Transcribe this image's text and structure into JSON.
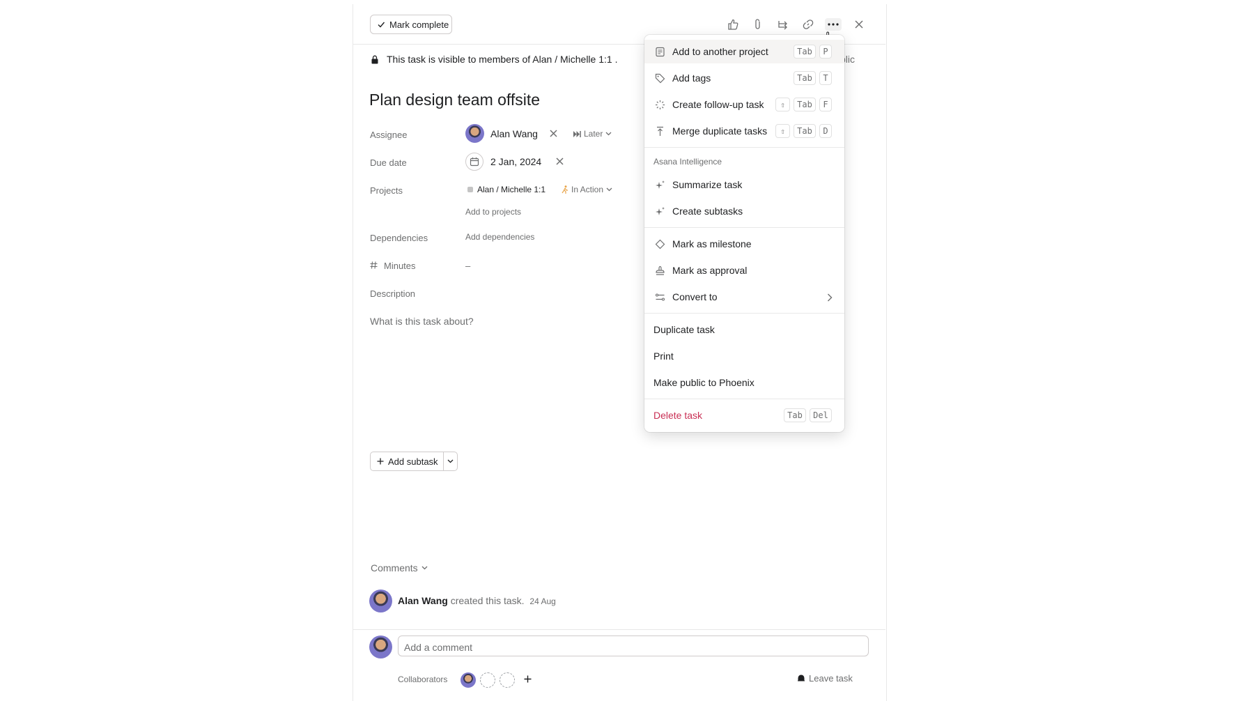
{
  "toolbar": {
    "mark_complete": "Mark complete",
    "icons": [
      "thumbs-up-icon",
      "paperclip-icon",
      "subtask-icon",
      "link-icon",
      "more-icon",
      "close-icon"
    ]
  },
  "visibility": {
    "text": "This task is visible to members of Alan / Michelle 1:1 .",
    "trailing": "blic"
  },
  "task": {
    "title": "Plan design team offsite",
    "fields": {
      "assignee_label": "Assignee",
      "assignee_name": "Alan Wang",
      "later_label": "Later",
      "due_label": "Due date",
      "due_value": "2 Jan, 2024",
      "projects_label": "Projects",
      "project_name": "Alan / Michelle 1:1",
      "project_section": "In Action",
      "add_projects": "Add to projects",
      "dependencies_label": "Dependencies",
      "add_dependencies": "Add dependencies",
      "minutes_label": "Minutes",
      "minutes_value": "–",
      "description_label": "Description",
      "description_placeholder": "What is this task about?"
    },
    "add_subtask": "Add subtask"
  },
  "comments": {
    "header": "Comments",
    "activity_author": "Alan Wang",
    "activity_text": "created this task.",
    "activity_date": "24 Aug",
    "comment_placeholder": "Add a comment",
    "collaborators_label": "Collaborators",
    "leave_task": "Leave task"
  },
  "menu": {
    "items": [
      {
        "label": "Add to another project",
        "keys": [
          "Tab",
          "P"
        ]
      },
      {
        "label": "Add tags",
        "keys": [
          "Tab",
          "T"
        ]
      },
      {
        "label": "Create follow-up task",
        "keys": [
          "⇧",
          "Tab",
          "F"
        ]
      },
      {
        "label": "Merge duplicate tasks",
        "keys": [
          "⇧",
          "Tab",
          "D"
        ]
      }
    ],
    "ai_header": "Asana Intelligence",
    "ai_items": [
      {
        "label": "Summarize task"
      },
      {
        "label": "Create subtasks"
      }
    ],
    "mark_items": [
      {
        "label": "Mark as milestone"
      },
      {
        "label": "Mark as approval"
      },
      {
        "label": "Convert to"
      }
    ],
    "plain_items": [
      {
        "label": "Duplicate task"
      },
      {
        "label": "Print"
      },
      {
        "label": "Make public to Phoenix"
      }
    ],
    "delete": {
      "label": "Delete task",
      "keys": [
        "Tab",
        "Del"
      ]
    }
  },
  "colors": {
    "delete_red": "#c92f54",
    "muted_text": "#6d6e6f",
    "border": "#e8e8e8"
  }
}
